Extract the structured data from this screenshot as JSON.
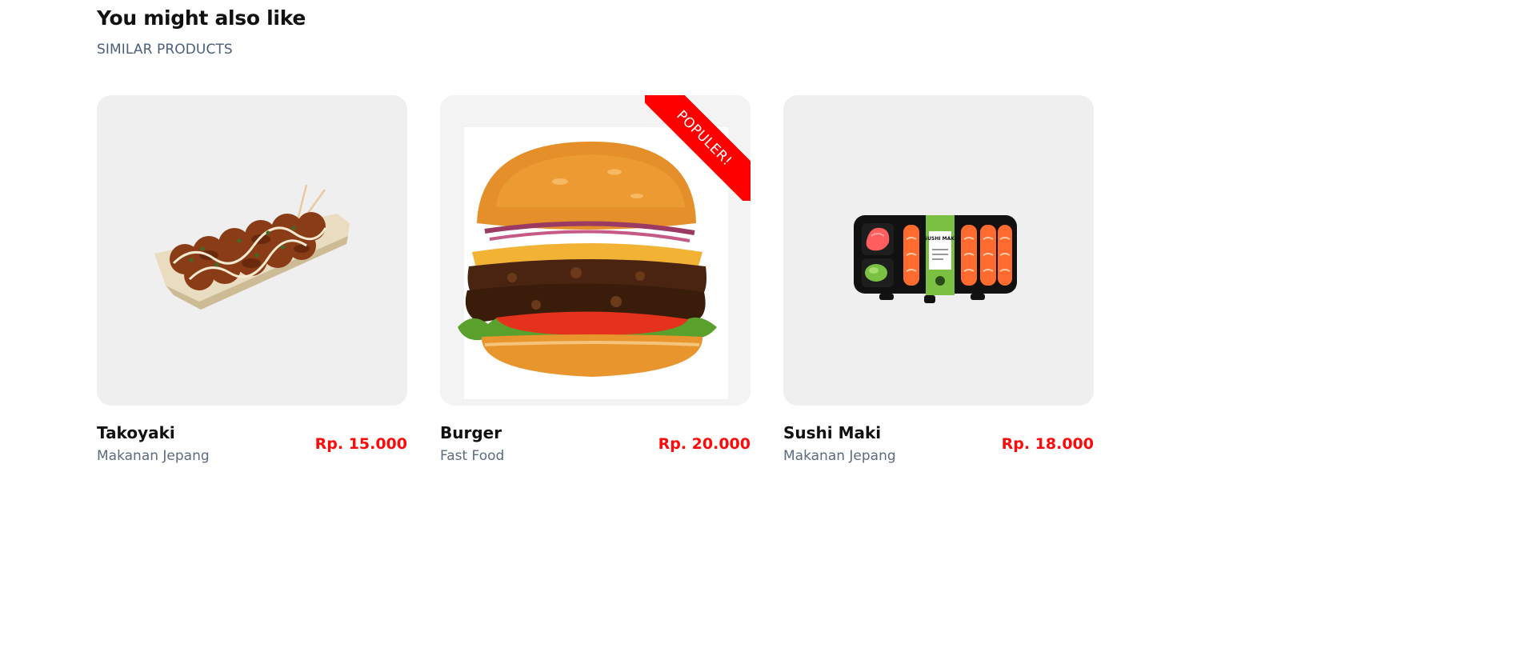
{
  "section": {
    "title": "You might also like",
    "subtitle": "SIMILAR PRODUCTS"
  },
  "products": [
    {
      "name": "Takoyaki",
      "category": "Makanan Jepang",
      "price": "Rp. 15.000",
      "image": "takoyaki-image"
    },
    {
      "name": "Burger",
      "category": "Fast Food",
      "price": "Rp. 20.000",
      "image": "burger-image",
      "ribbon": "POPULER!"
    },
    {
      "name": "Sushi Maki",
      "category": "Makanan Jepang",
      "price": "Rp. 18.000",
      "image": "sushi-maki-image",
      "pack_label": "SUSHI MAKI"
    }
  ],
  "colors": {
    "accent": "#ff0000",
    "price": "#ff0a0a",
    "thumb_bg": "#efefef",
    "muted_text": "#5b6b82"
  }
}
